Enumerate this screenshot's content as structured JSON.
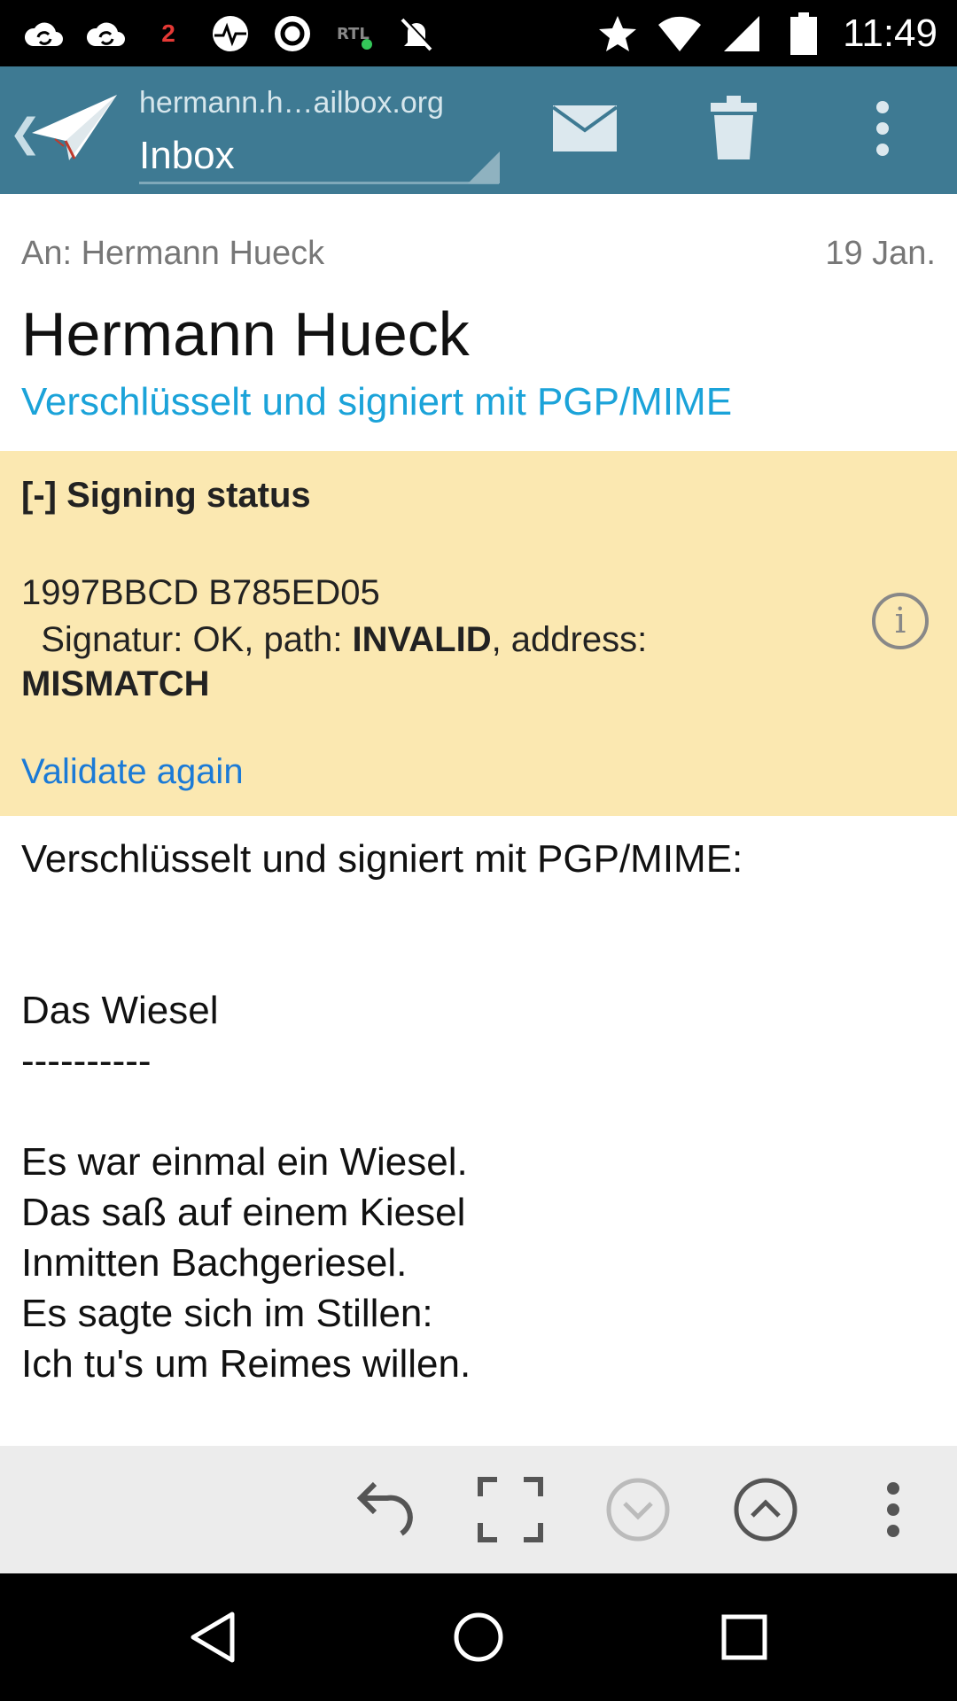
{
  "status_bar": {
    "time": "11:49",
    "notification_count": "2",
    "icons": [
      "cloud-sync-icon",
      "cloud-sync-icon",
      "number-two-icon",
      "globe-pulse-icon",
      "circle-a-icon",
      "rtl-app-icon",
      "notifications-off-icon",
      "star-icon",
      "wifi-icon",
      "signal-icon",
      "battery-icon"
    ]
  },
  "app_bar": {
    "account": "hermann.h…ailbox.org",
    "folder": "Inbox",
    "icons": [
      "back-chevron-icon",
      "paper-plane-logo",
      "envelope-icon",
      "trash-icon",
      "overflow-menu-icon"
    ]
  },
  "message": {
    "to_line": "An: Hermann Hueck",
    "date": "19 Jan.",
    "sender": "Hermann Hueck",
    "crypto_label": "Verschlüsselt und signiert mit PGP/MIME"
  },
  "signing": {
    "title": "[-] Signing status",
    "key_id": "1997BBCD B785ED05",
    "status_prefix": "Signatur: OK, path: ",
    "path_value": "INVALID",
    "status_mid": ", address:",
    "address_value": "MISMATCH",
    "validate_link": "Validate again",
    "info_icon": "info-icon"
  },
  "body": {
    "text": "Verschlüsselt und signiert mit PGP/MIME:\n\n\nDas Wiesel\n----------\n\nEs war einmal ein Wiesel.\nDas saß auf einem Kiesel\nInmitten Bachgeriesel.\nEs sagte sich im Stillen:\nIch tu's um Reimes willen."
  },
  "bottom_bar": {
    "icons": [
      "reply-icon",
      "fullscreen-icon",
      "next-message-icon",
      "previous-message-icon",
      "overflow-menu-icon"
    ]
  },
  "nav_bar": {
    "icons": [
      "back-icon",
      "home-icon",
      "recents-icon"
    ]
  },
  "colors": {
    "app_bar": "#3e7a93",
    "signing_box": "#fbe8b1",
    "link_blue": "#1b7ad6",
    "crypto_blue": "#1ba3d9",
    "bottom_bar": "#ececec"
  }
}
